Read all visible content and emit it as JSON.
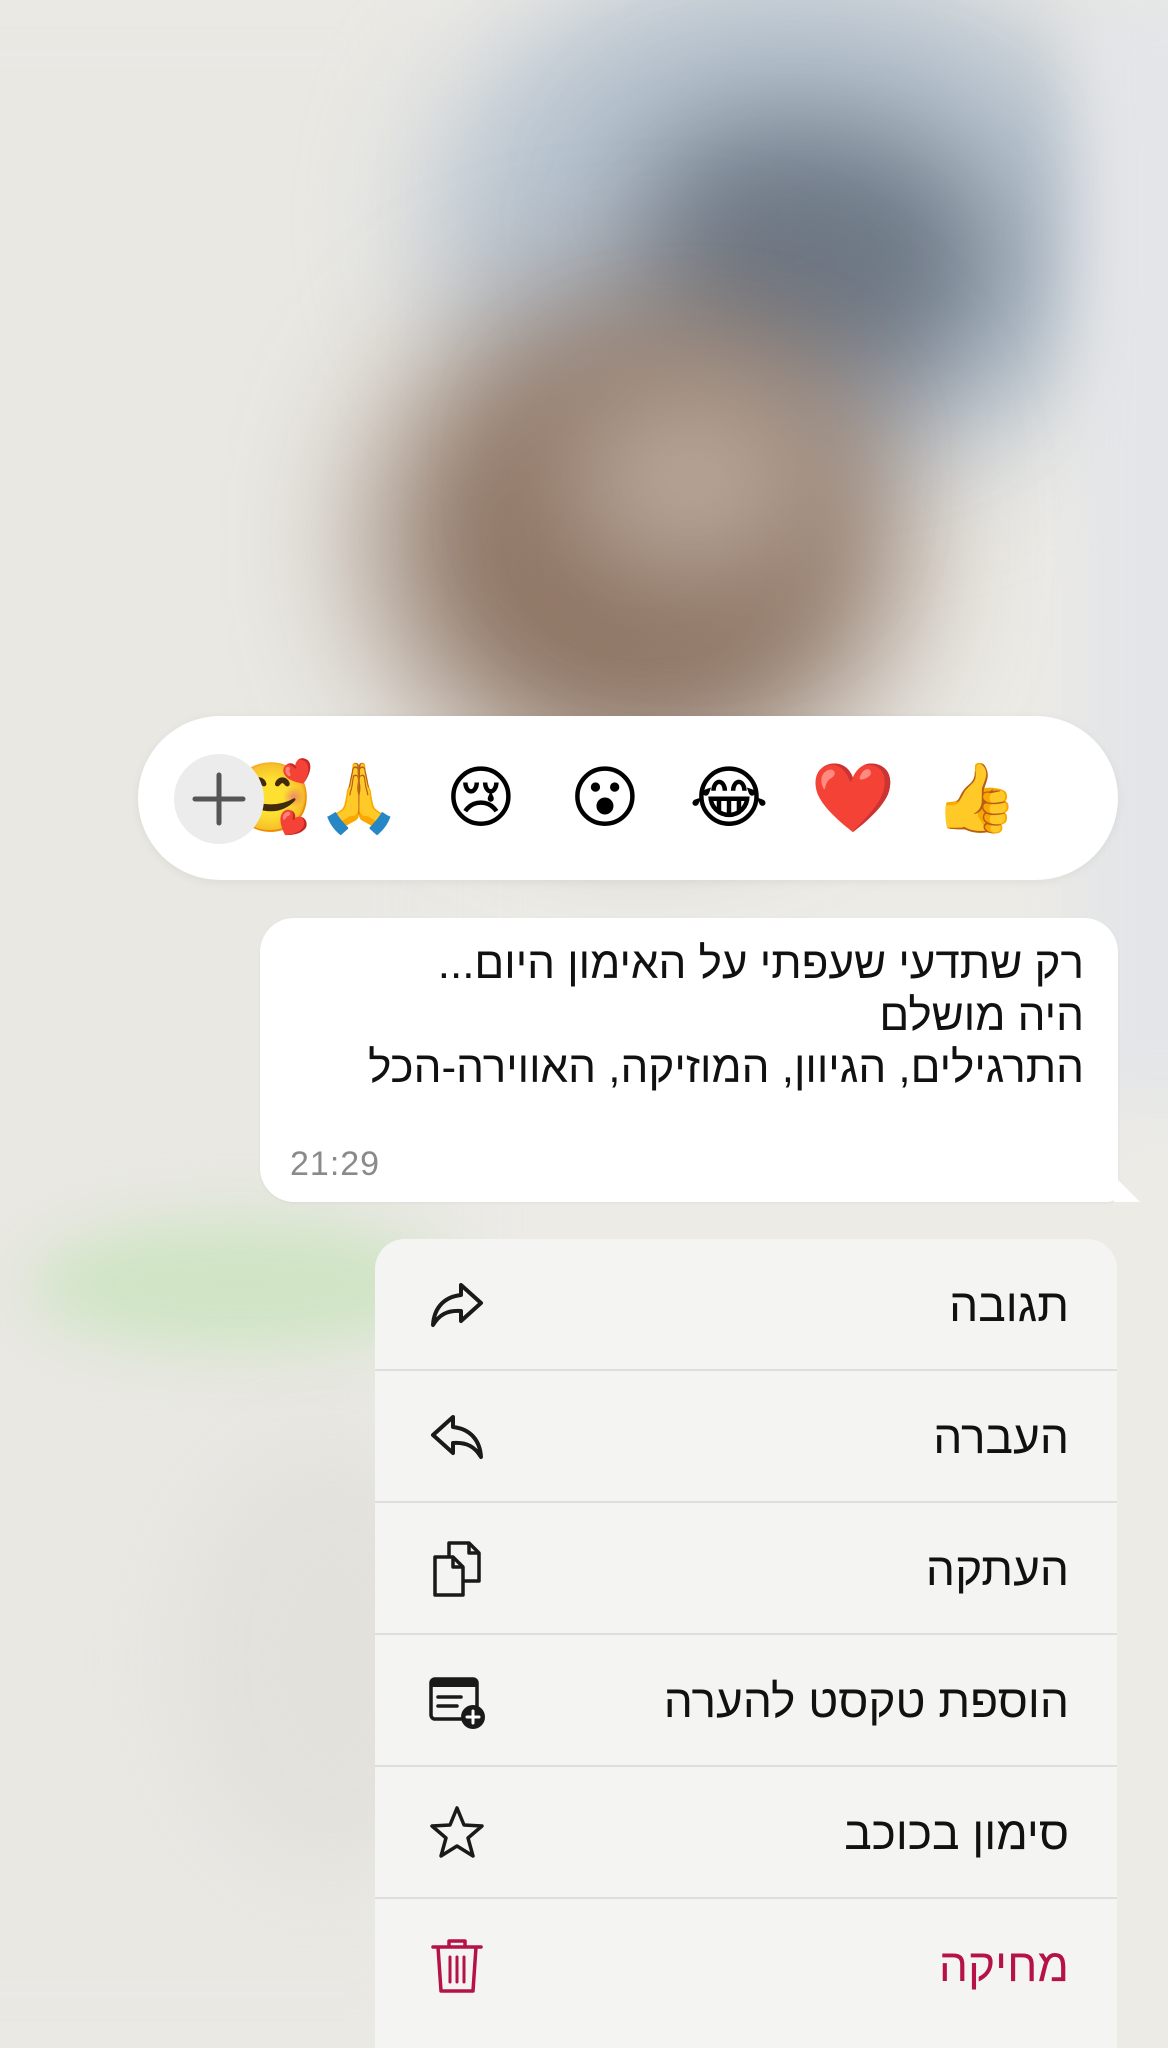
{
  "reactions": {
    "add_label": "+",
    "emojis": [
      "👍",
      "❤️",
      "😂",
      "😮",
      "😢",
      "🙏",
      "🥰"
    ]
  },
  "message": {
    "lines": [
      "רק שתדעי שעפתי על האימון היום...",
      "היה מושלם",
      "התרגילים, הגיוון, המוזיקה, האווירה-הכל"
    ],
    "time": "21:29"
  },
  "menu": {
    "items": [
      {
        "label": "תגובה",
        "icon": "reply-icon"
      },
      {
        "label": "העברה",
        "icon": "forward-icon"
      },
      {
        "label": "העתקה",
        "icon": "copy-icon"
      },
      {
        "label": "הוספת טקסט להערה",
        "icon": "add-note-icon"
      },
      {
        "label": "סימון בכוכב",
        "icon": "star-icon"
      },
      {
        "label": "מחיקה",
        "icon": "trash-icon"
      }
    ]
  },
  "colors": {
    "danger": "#b5124a",
    "menu_background": "#f4f4f3",
    "bubble_background": "#ffffff"
  }
}
